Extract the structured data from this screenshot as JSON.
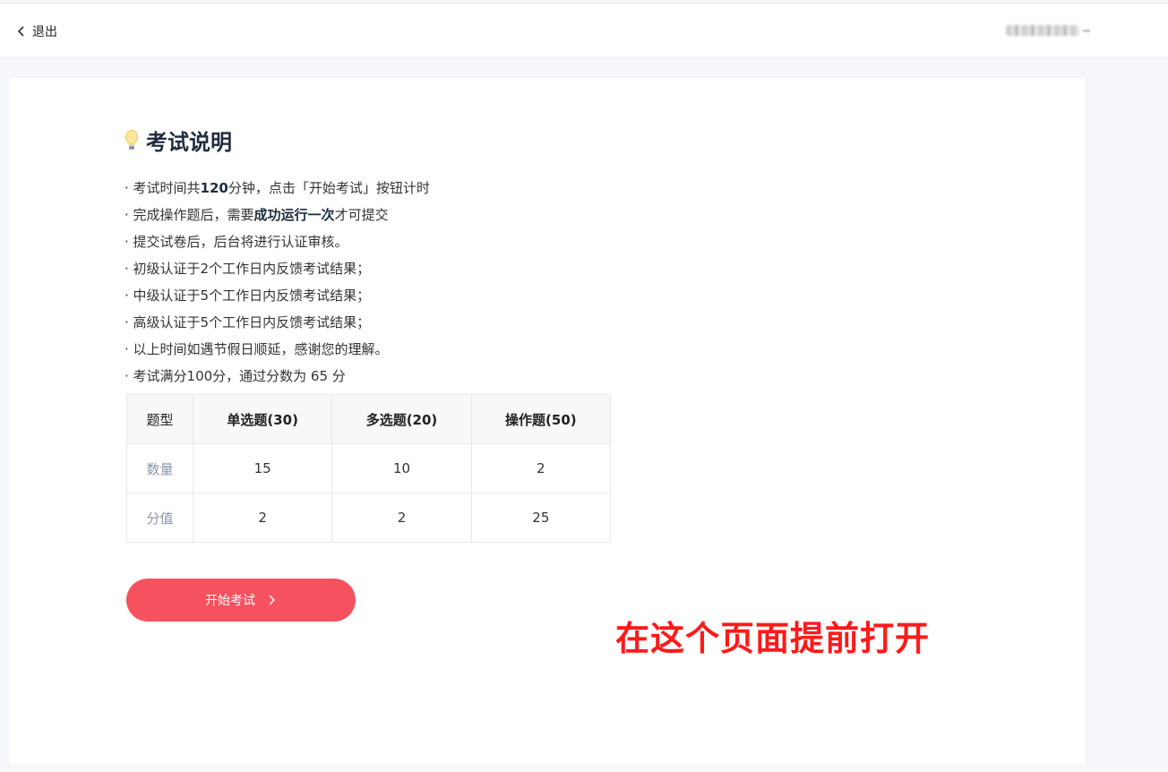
{
  "header": {
    "back_label": "退出",
    "user_name_blurred": "pxxxxxxx"
  },
  "content": {
    "title": "考试说明",
    "notes": [
      {
        "pre": "· 考试时间共",
        "bold": "120",
        "post": "分钟，点击「开始考试」按钮计时"
      },
      {
        "pre": "· 完成操作题后，需要",
        "bold": "成功运行一次",
        "post": "才可提交"
      },
      {
        "pre": "· 提交试卷后，后台将进行认证审核。",
        "bold": "",
        "post": ""
      },
      {
        "pre": "· 初级认证于2个工作日内反馈考试结果；",
        "bold": "",
        "post": ""
      },
      {
        "pre": "· 中级认证于5个工作日内反馈考试结果；",
        "bold": "",
        "post": ""
      },
      {
        "pre": "· 高级认证于5个工作日内反馈考试结果；",
        "bold": "",
        "post": ""
      },
      {
        "pre": "· 以上时间如遇节假日顺延，感谢您的理解。",
        "bold": "",
        "post": ""
      },
      {
        "pre": "· 考试满分100分，通过分数为 65 分",
        "bold": "",
        "post": ""
      }
    ],
    "table": {
      "header": [
        "题型",
        "单选题(30)",
        "多选题(20)",
        "操作题(50)"
      ],
      "rows": [
        [
          "数量",
          "15",
          "10",
          "2"
        ],
        [
          "分值",
          "2",
          "2",
          "25"
        ]
      ]
    },
    "start_button_label": "开始考试"
  },
  "annotation_text": "在这个页面提前打开",
  "colors": {
    "accent": "#f5515f",
    "annotation": "#ff1a1a",
    "title": "#1f2d3d"
  }
}
